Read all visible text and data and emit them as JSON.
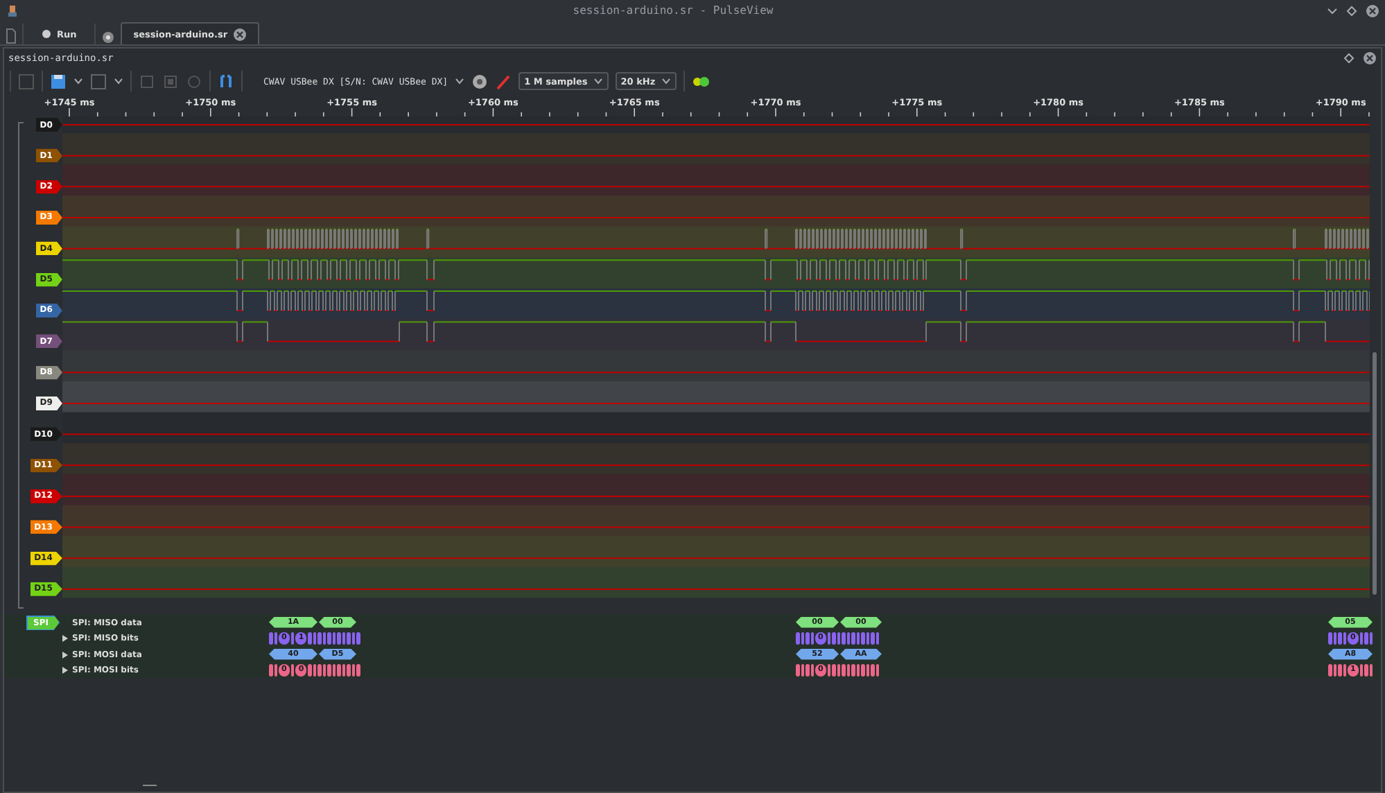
{
  "window": {
    "title": "session-arduino.sr - PulseView"
  },
  "main_toolbar": {
    "run_button": "Run"
  },
  "tabs": [
    {
      "label": "session-arduino.sr",
      "selected": true
    }
  ],
  "session": {
    "title": "session-arduino.sr",
    "device": "CWAV USBee DX [S/N: CWAV USBee DX]",
    "sample_count": "1 M samples",
    "sample_rate": "20 kHz"
  },
  "ruler": {
    "ticks": [
      "+1745 ms",
      "+1750 ms",
      "+1755 ms",
      "+1760 ms",
      "+1765 ms",
      "+1770 ms",
      "+1775 ms",
      "+1780 ms",
      "+1785 ms",
      "+1790 ms"
    ]
  },
  "channels": [
    {
      "name": "D0",
      "color": "#1a1a1a"
    },
    {
      "name": "D1",
      "color": "#8f5202"
    },
    {
      "name": "D2",
      "color": "#cc0000"
    },
    {
      "name": "D3",
      "color": "#f57900"
    },
    {
      "name": "D4",
      "color": "#edd400"
    },
    {
      "name": "D5",
      "color": "#73d216"
    },
    {
      "name": "D6",
      "color": "#3465a4"
    },
    {
      "name": "D7",
      "color": "#75507b"
    },
    {
      "name": "D8",
      "color": "#88887f"
    },
    {
      "name": "D9",
      "color": "#eeeeec"
    },
    {
      "name": "D10",
      "color": "#1a1a1a"
    },
    {
      "name": "D11",
      "color": "#8f5202"
    },
    {
      "name": "D12",
      "color": "#cc0000"
    },
    {
      "name": "D13",
      "color": "#f57900"
    },
    {
      "name": "D14",
      "color": "#edd400"
    },
    {
      "name": "D15",
      "color": "#73d216"
    }
  ],
  "decoder": {
    "name": "SPI",
    "color": "#5cc93b",
    "rows": [
      {
        "label": "SPI: MISO data",
        "kind": "data",
        "collapsible": false,
        "color": "#7ee07e",
        "annotations": [
          "1A",
          "00",
          "00",
          "00",
          "05"
        ]
      },
      {
        "label": "SPI: MISO bits",
        "kind": "bits",
        "collapsible": true,
        "color": "#8a63f0",
        "annotations": [
          "0",
          "1",
          "0",
          "0"
        ]
      },
      {
        "label": "SPI: MOSI data",
        "kind": "data",
        "collapsible": true,
        "color": "#72a7ec",
        "annotations": [
          "40",
          "D5",
          "52",
          "AA",
          "A8"
        ]
      },
      {
        "label": "SPI: MOSI bits",
        "kind": "bits",
        "collapsible": true,
        "color": "#ec6689",
        "annotations": [
          "0",
          "0",
          "0",
          "1"
        ]
      }
    ]
  }
}
